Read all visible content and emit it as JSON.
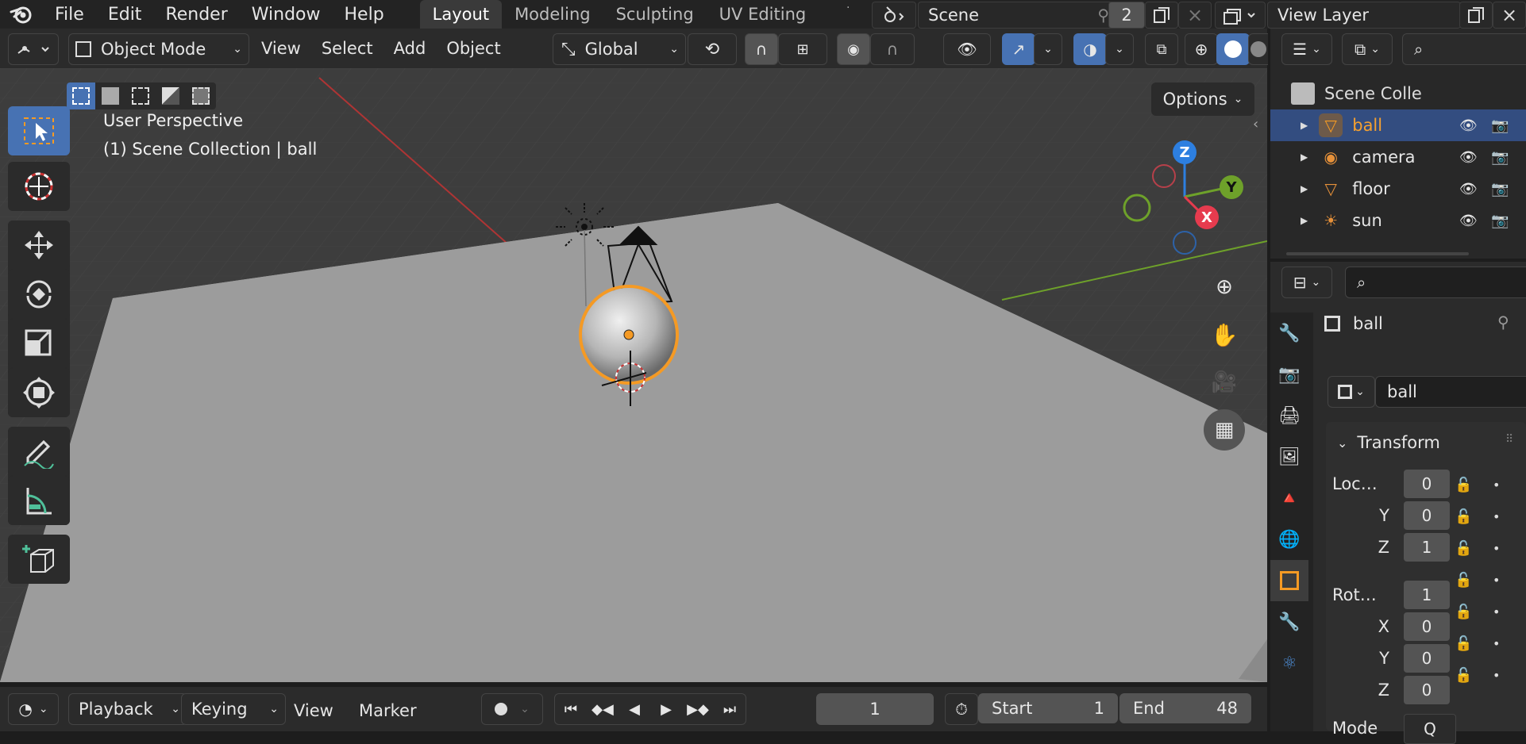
{
  "menu": [
    "File",
    "Edit",
    "Render",
    "Window",
    "Help"
  ],
  "workspaces": [
    "Layout",
    "Modeling",
    "Sculpting",
    "UV Editing"
  ],
  "scene": {
    "name": "Scene",
    "users": "2"
  },
  "view_layer": "View Layer",
  "header": {
    "mode": "Object Mode",
    "menus": [
      "View",
      "Select",
      "Add",
      "Object"
    ],
    "orientation": "Global",
    "options": "Options"
  },
  "viewport": {
    "perspective": "User Perspective",
    "collection": "(1) Scene Collection | ball",
    "gizmo": {
      "z": "Z",
      "y": "Y",
      "x": "X"
    }
  },
  "timeline": {
    "menus": [
      "Playback",
      "Keying",
      "View",
      "Marker"
    ],
    "current_frame": "1",
    "start_label": "Start",
    "start": "1",
    "end_label": "End",
    "end": "48"
  },
  "outliner": {
    "root": "Scene Colle",
    "items": [
      {
        "name": "ball",
        "icon": "mesh-icon",
        "selected": true
      },
      {
        "name": "camera",
        "icon": "camera-icon",
        "selected": false
      },
      {
        "name": "floor",
        "icon": "mesh-icon",
        "selected": false
      },
      {
        "name": "sun",
        "icon": "light-icon",
        "selected": false
      }
    ]
  },
  "properties": {
    "object_name": "ball",
    "data_name": "ball",
    "panel": "Transform",
    "location_label": "Loc…",
    "rotation_label": "Rot…",
    "mode_label": "Mode",
    "mode_value": "Q",
    "location": [
      {
        "axis": "",
        "value": "0"
      },
      {
        "axis": "Y",
        "value": "0"
      },
      {
        "axis": "Z",
        "value": "1"
      }
    ],
    "rotation": [
      {
        "axis": "",
        "value": "1"
      },
      {
        "axis": "X",
        "value": "0"
      },
      {
        "axis": "Y",
        "value": "0"
      },
      {
        "axis": "Z",
        "value": "0"
      }
    ]
  },
  "colors": {
    "accent": "#4772b3",
    "selected_orange": "#f59a24",
    "x_axis": "#e63b4e",
    "y_axis": "#6ea12a",
    "z_axis": "#2d7fe0"
  }
}
